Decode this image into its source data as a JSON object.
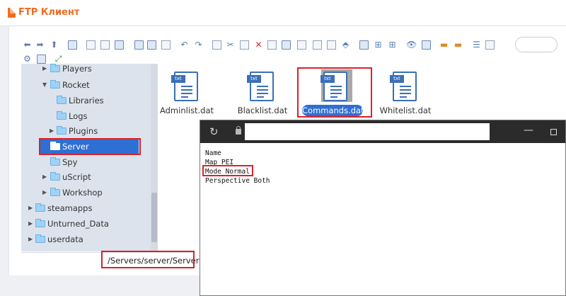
{
  "app": {
    "title": "FTP Клиент"
  },
  "tree": {
    "items": [
      {
        "label": "Players",
        "level": 2,
        "expandable": true
      },
      {
        "label": "Rocket",
        "level": 2,
        "expanded": true
      },
      {
        "label": "Libraries",
        "level": 3
      },
      {
        "label": "Logs",
        "level": 3
      },
      {
        "label": "Plugins",
        "level": 3,
        "expandable": true
      },
      {
        "label": "Server",
        "level": 2,
        "selected": true
      },
      {
        "label": "Spy",
        "level": 2
      },
      {
        "label": "uScript",
        "level": 2,
        "expandable": true
      },
      {
        "label": "Workshop",
        "level": 2,
        "expandable": true
      },
      {
        "label": "steamapps",
        "level": 1,
        "expandable": true
      },
      {
        "label": "Unturned_Data",
        "level": 1,
        "expandable": true
      },
      {
        "label": "userdata",
        "level": 1,
        "expandable": true
      }
    ]
  },
  "path": {
    "current": "/Servers/server/Server"
  },
  "files": {
    "tag": "txt",
    "items": [
      {
        "name": "Adminlist.dat"
      },
      {
        "name": "Blacklist.dat"
      },
      {
        "name": "Commands.dat",
        "selected": true
      },
      {
        "name": "Whitelist.dat"
      }
    ]
  },
  "editor": {
    "lines": [
      "Name",
      "Map PEI",
      "Mode Normal",
      "Perspective Both"
    ]
  },
  "colors": {
    "accent": "#f26b21",
    "selection": "#2f6fd3",
    "highlight_box": "#d8232a"
  }
}
